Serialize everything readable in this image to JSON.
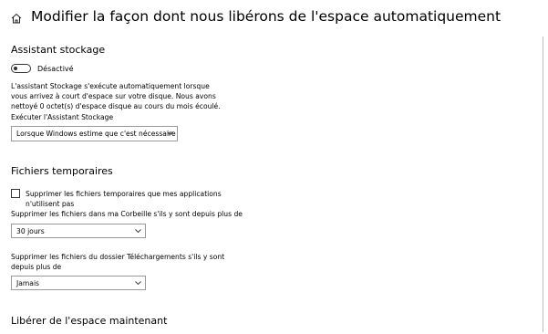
{
  "header": {
    "title": "Modifier la façon dont nous libérons de l'espace automatiquement"
  },
  "storage_sense": {
    "title": "Assistant stockage",
    "toggle_state": "Désactivé",
    "description": "L'assistant Stockage s'exécute automatiquement lorsque vous arrivez à court d'espace sur votre disque. Nous avons nettoyé 0 octet(s) d'espace disque au cours du mois écoulé.",
    "run_label": "Exécuter l'Assistant Stockage",
    "run_value": "Lorsque Windows estime que c'est nécessaire"
  },
  "temp_files": {
    "title": "Fichiers temporaires",
    "delete_apps_label": "Supprimer les fichiers temporaires que mes applications n'utilisent pas",
    "recycle_label": "Supprimer les fichiers dans ma Corbeille s'ils y sont depuis plus de",
    "recycle_value": "30 jours",
    "downloads_label": "Supprimer les fichiers du dossier Téléchargements s'ils y sont depuis plus de",
    "downloads_value": "Jamais"
  },
  "free_now": {
    "title": "Libérer de l'espace maintenant"
  },
  "icons": {
    "home": "home-icon",
    "chevron": "chevron-down-icon"
  }
}
